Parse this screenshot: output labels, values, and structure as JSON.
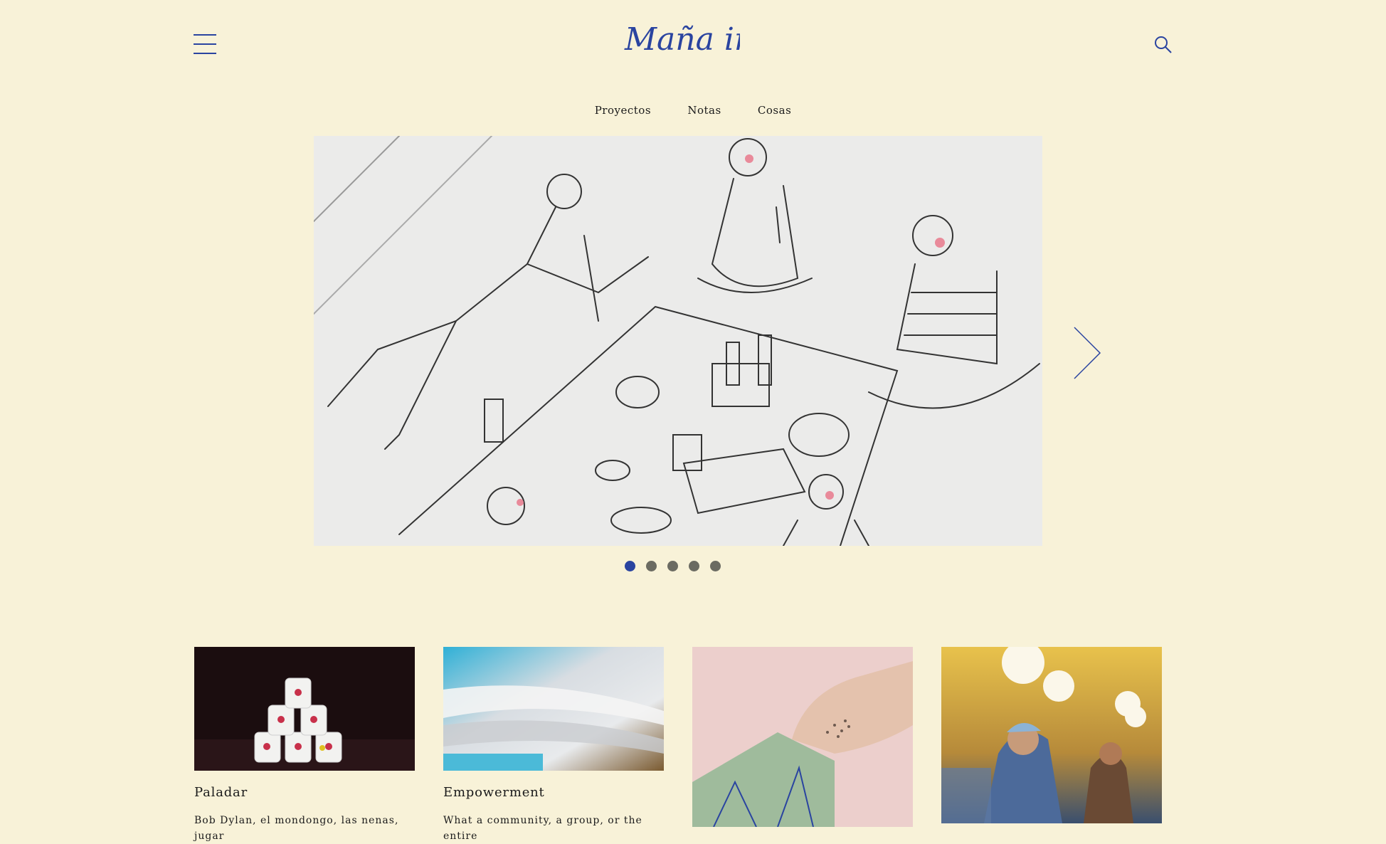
{
  "header": {
    "logo_text": "Maña ind.",
    "menu_icon": "hamburger-menu-icon",
    "search_icon": "search-icon"
  },
  "nav": {
    "items": [
      {
        "label": "Proyectos"
      },
      {
        "label": "Notas"
      },
      {
        "label": "Cosas"
      }
    ]
  },
  "carousel": {
    "slide_description": "pencil-sketch-picnic-illustration",
    "next_icon": "chevron-right-icon",
    "slide_count": 5,
    "active_index": 0
  },
  "cards": [
    {
      "title": "Paladar",
      "excerpt": "Bob Dylan, el mondongo, las nenas, jugar",
      "image": "enamel-mugs-photo"
    },
    {
      "title": "Empowerment",
      "excerpt": "What a community, a group, or the entire",
      "image": "printed-paper-stack-photo"
    },
    {
      "title": "",
      "excerpt": "",
      "image": "gloved-hand-green-folder-photo"
    },
    {
      "title": "",
      "excerpt": "",
      "image": "cafe-barista-photo"
    }
  ],
  "colors": {
    "background": "#f8f2d8",
    "accent": "#2a44a0",
    "inactive_dot": "#6b6b62"
  }
}
